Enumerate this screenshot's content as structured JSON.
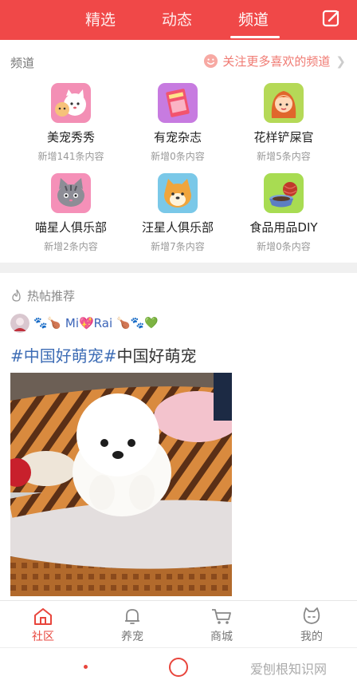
{
  "top_tabs": [
    {
      "label": "精选"
    },
    {
      "label": "动态"
    },
    {
      "label": "频道"
    }
  ],
  "active_tab": "频道",
  "channels_section": {
    "title": "频道",
    "follow_link": "关注更多喜欢的频道",
    "items": [
      {
        "name": "美宠秀秀",
        "sub": "新增141条内容",
        "icon": "cat-dog-icon"
      },
      {
        "name": "有宠杂志",
        "sub": "新增0条内容",
        "icon": "magazine-icon"
      },
      {
        "name": "花样铲屎官",
        "sub": "新增5条内容",
        "icon": "girl-icon"
      },
      {
        "name": "喵星人俱乐部",
        "sub": "新增2条内容",
        "icon": "cat-icon"
      },
      {
        "name": "汪星人俱乐部",
        "sub": "新增7条内容",
        "icon": "dog-icon"
      },
      {
        "name": "食品用品DIY",
        "sub": "新增0条内容",
        "icon": "bowl-yarn-icon"
      }
    ]
  },
  "hot_section": {
    "title": "热帖推荐",
    "post": {
      "username_pre": "🐾🍗",
      "username": "Mi💖Rai",
      "username_post": "🍗🐾💚",
      "tag": "#中国好萌宠#",
      "title": "中国好萌宠"
    }
  },
  "bottom_nav": [
    {
      "label": "社区",
      "icon": "house-icon",
      "active": true
    },
    {
      "label": "养宠",
      "icon": "bell-icon",
      "active": false
    },
    {
      "label": "商城",
      "icon": "cart-icon",
      "active": false
    },
    {
      "label": "我的",
      "icon": "pet-face-icon",
      "active": false
    }
  ],
  "watermark": "爱刨根知识网",
  "colors": {
    "brand": "#f04848",
    "active_nav": "#e8453c",
    "link": "#3e6db5"
  }
}
